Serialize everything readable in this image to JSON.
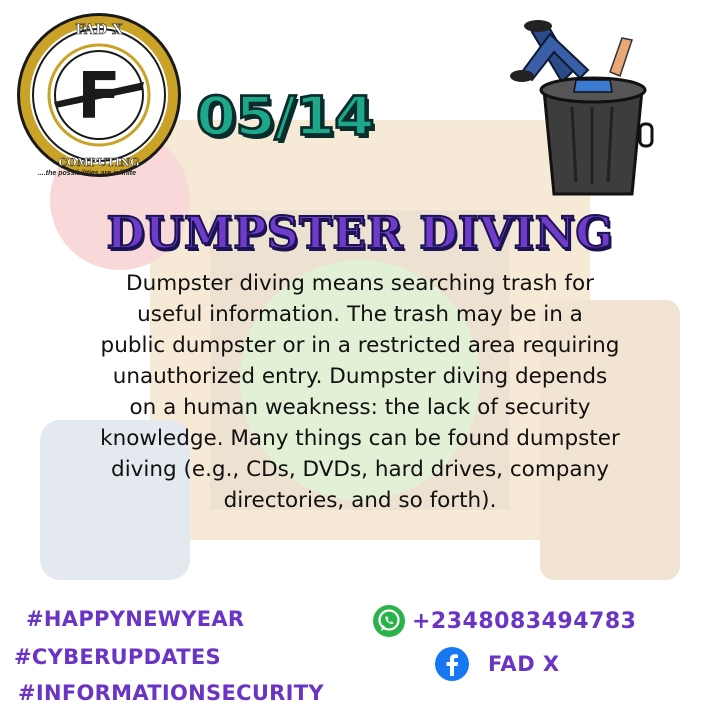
{
  "logo": {
    "top_text": "FAD X",
    "letter": "F",
    "bottom_text": "COMPUTING",
    "tagline": "....the possibilities are infinite"
  },
  "date": "05/14",
  "title": "DUMPSTER DIVING",
  "body_lines": [
    "Dumpster diving means searching trash for",
    "useful information. The trash may be in a",
    "public dumpster or in a restricted area requiring",
    "unauthorized entry. Dumpster diving depends",
    "on a human weakness: the lack of security",
    "knowledge. Many things can be found dumpster",
    "diving (e.g., CDs, DVDs, hard drives, company",
    "directories, and so forth)."
  ],
  "hashtags": [
    "#HAPPYNEWYEAR",
    "#CYBERUPDATES",
    "#INFORMATIONSECURITY"
  ],
  "contacts": {
    "phone_icon": "whatsapp-icon",
    "phone": "+2348083494783",
    "facebook_icon": "facebook-icon",
    "facebook": "FAD X"
  },
  "colors": {
    "date_fill": "#1ea88b",
    "title_fill": "#6e3cc9",
    "hashtag": "#6a34c4",
    "whatsapp": "#29b34a",
    "facebook": "#1877f2",
    "logo_gold": "#c9a227"
  }
}
